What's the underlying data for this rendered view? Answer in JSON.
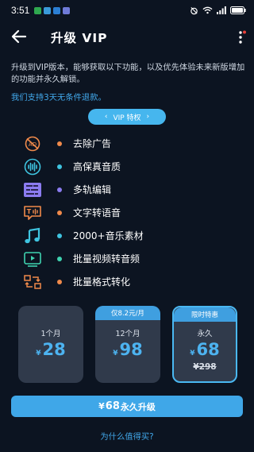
{
  "status_bar": {
    "time": "3:51",
    "battery": "100"
  },
  "header": {
    "title": "升级 VIP"
  },
  "intro": {
    "description": "升级到VIP版本，能够获取以下功能，以及优先体验未来新版增加的功能并永久解锁。",
    "refund_note": "我们支持3天无条件退款。"
  },
  "vip_badge": {
    "label": "VIP 特权",
    "left_arrow": "‹",
    "right_arrow": "›"
  },
  "features": [
    {
      "label": "去除广告",
      "icon": "no-ads-icon",
      "dot_color": "#f08a4b"
    },
    {
      "label": "高保真音质",
      "icon": "audio-wave-icon",
      "dot_color": "#3fc4e0"
    },
    {
      "label": "多轨编辑",
      "icon": "multitrack-icon",
      "dot_color": "#8b7cf0"
    },
    {
      "label": "文字转语音",
      "icon": "text-to-speech-icon",
      "dot_color": "#f08a4b"
    },
    {
      "label": "2000+音乐素材",
      "icon": "music-note-icon",
      "dot_color": "#3fc4e0"
    },
    {
      "label": "批量视频转音频",
      "icon": "video-to-audio-icon",
      "dot_color": "#3fd3b0"
    },
    {
      "label": "批量格式转化",
      "icon": "format-convert-icon",
      "dot_color": "#f08a4b"
    }
  ],
  "plans": [
    {
      "name": "1个月",
      "currency": "¥",
      "price": "28",
      "badge": "",
      "original": "",
      "selected": false
    },
    {
      "name": "12个月",
      "currency": "¥",
      "price": "98",
      "badge": "仅8.2元/月",
      "original": "",
      "selected": false
    },
    {
      "name": "永久",
      "currency": "¥",
      "price": "68",
      "badge": "限时特惠",
      "original": "¥298",
      "selected": true
    }
  ],
  "buy_button": {
    "currency": "¥",
    "price": "68",
    "label": "永久升级"
  },
  "why_link": "为什么值得买?",
  "colors": {
    "background": "#0c1421",
    "accent": "#3fa7e8",
    "card": "#303a4b",
    "link": "#42a9ec"
  }
}
